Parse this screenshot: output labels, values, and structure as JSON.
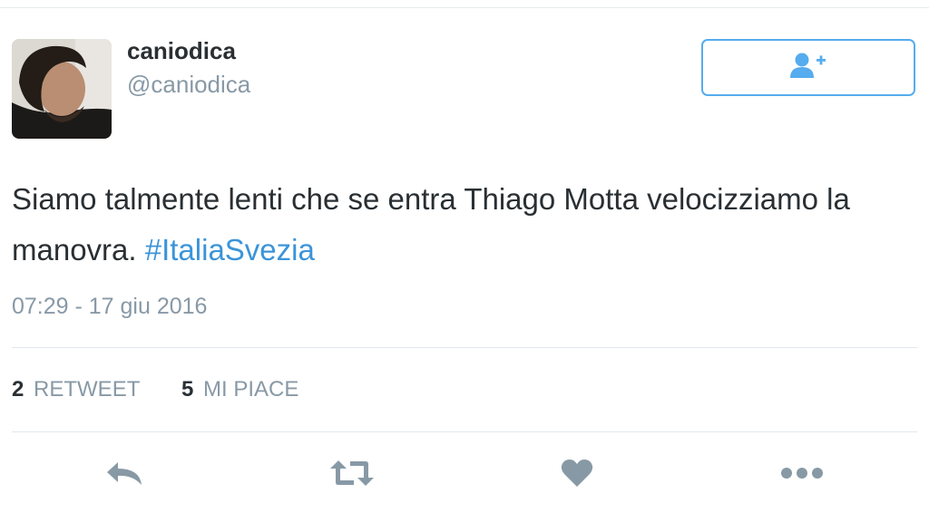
{
  "user": {
    "display_name": "caniodica",
    "handle": "@caniodica"
  },
  "follow_button": {
    "icon": "follow-user-icon"
  },
  "tweet": {
    "text": "Siamo talmente lenti che se entra Thiago Motta velocizziamo la manovra.",
    "hashtag": "#ItaliaSvezia",
    "timestamp": "07:29 - 17 giu 2016"
  },
  "stats": {
    "retweets_count": "2",
    "retweets_label": "RETWEET",
    "likes_count": "5",
    "likes_label": "MI PIACE"
  },
  "actions": {
    "reply_icon": "reply-icon",
    "retweet_icon": "retweet-icon",
    "like_icon": "heart-icon",
    "more_icon": "more-icon"
  },
  "colors": {
    "accent": "#55acee",
    "hashtag": "#3b94d9",
    "muted_text": "#8899a6",
    "action_icon": "#8899a6",
    "body_text": "#292f33"
  }
}
